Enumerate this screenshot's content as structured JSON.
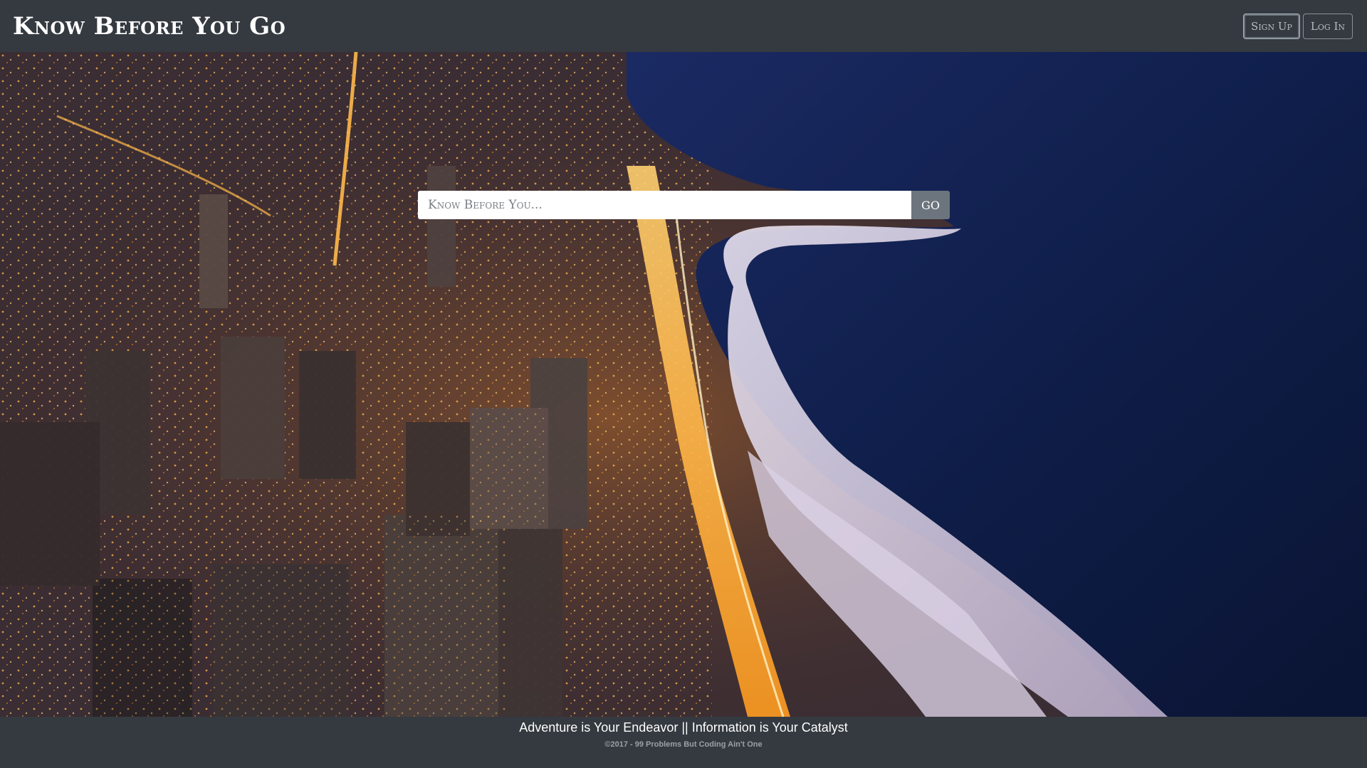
{
  "header": {
    "brand": "Know Before You Go",
    "sign_up_label": "Sign Up",
    "log_in_label": "Log In"
  },
  "search": {
    "placeholder": "Know Before You...",
    "value": "",
    "go_label": "GO"
  },
  "hero": {
    "image_description_icon": "city-skyline-lakefront-photo"
  },
  "footer": {
    "tagline": "Adventure is Your Endeavor || Information is Your Catalyst",
    "copyright": "©2017 - 99 Problems But Coding Ain't One"
  },
  "colors": {
    "navbar": "#343a40",
    "button_gray": "#6c757d",
    "lake": "#0c1a3e",
    "city_lights": "#f0a030"
  }
}
